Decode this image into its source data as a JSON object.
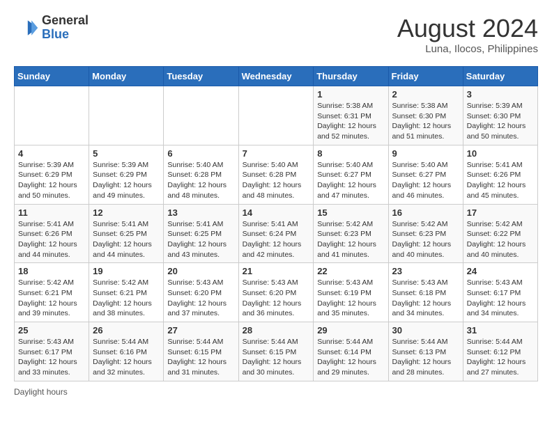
{
  "header": {
    "logo_general": "General",
    "logo_blue": "Blue",
    "month_year": "August 2024",
    "location": "Luna, Ilocos, Philippines"
  },
  "weekdays": [
    "Sunday",
    "Monday",
    "Tuesday",
    "Wednesday",
    "Thursday",
    "Friday",
    "Saturday"
  ],
  "weeks": [
    [
      {
        "day": "",
        "info": ""
      },
      {
        "day": "",
        "info": ""
      },
      {
        "day": "",
        "info": ""
      },
      {
        "day": "",
        "info": ""
      },
      {
        "day": "1",
        "info": "Sunrise: 5:38 AM\nSunset: 6:31 PM\nDaylight: 12 hours and 52 minutes."
      },
      {
        "day": "2",
        "info": "Sunrise: 5:38 AM\nSunset: 6:30 PM\nDaylight: 12 hours and 51 minutes."
      },
      {
        "day": "3",
        "info": "Sunrise: 5:39 AM\nSunset: 6:30 PM\nDaylight: 12 hours and 50 minutes."
      }
    ],
    [
      {
        "day": "4",
        "info": "Sunrise: 5:39 AM\nSunset: 6:29 PM\nDaylight: 12 hours and 50 minutes."
      },
      {
        "day": "5",
        "info": "Sunrise: 5:39 AM\nSunset: 6:29 PM\nDaylight: 12 hours and 49 minutes."
      },
      {
        "day": "6",
        "info": "Sunrise: 5:40 AM\nSunset: 6:28 PM\nDaylight: 12 hours and 48 minutes."
      },
      {
        "day": "7",
        "info": "Sunrise: 5:40 AM\nSunset: 6:28 PM\nDaylight: 12 hours and 48 minutes."
      },
      {
        "day": "8",
        "info": "Sunrise: 5:40 AM\nSunset: 6:27 PM\nDaylight: 12 hours and 47 minutes."
      },
      {
        "day": "9",
        "info": "Sunrise: 5:40 AM\nSunset: 6:27 PM\nDaylight: 12 hours and 46 minutes."
      },
      {
        "day": "10",
        "info": "Sunrise: 5:41 AM\nSunset: 6:26 PM\nDaylight: 12 hours and 45 minutes."
      }
    ],
    [
      {
        "day": "11",
        "info": "Sunrise: 5:41 AM\nSunset: 6:26 PM\nDaylight: 12 hours and 44 minutes."
      },
      {
        "day": "12",
        "info": "Sunrise: 5:41 AM\nSunset: 6:25 PM\nDaylight: 12 hours and 44 minutes."
      },
      {
        "day": "13",
        "info": "Sunrise: 5:41 AM\nSunset: 6:25 PM\nDaylight: 12 hours and 43 minutes."
      },
      {
        "day": "14",
        "info": "Sunrise: 5:41 AM\nSunset: 6:24 PM\nDaylight: 12 hours and 42 minutes."
      },
      {
        "day": "15",
        "info": "Sunrise: 5:42 AM\nSunset: 6:23 PM\nDaylight: 12 hours and 41 minutes."
      },
      {
        "day": "16",
        "info": "Sunrise: 5:42 AM\nSunset: 6:23 PM\nDaylight: 12 hours and 40 minutes."
      },
      {
        "day": "17",
        "info": "Sunrise: 5:42 AM\nSunset: 6:22 PM\nDaylight: 12 hours and 40 minutes."
      }
    ],
    [
      {
        "day": "18",
        "info": "Sunrise: 5:42 AM\nSunset: 6:21 PM\nDaylight: 12 hours and 39 minutes."
      },
      {
        "day": "19",
        "info": "Sunrise: 5:42 AM\nSunset: 6:21 PM\nDaylight: 12 hours and 38 minutes."
      },
      {
        "day": "20",
        "info": "Sunrise: 5:43 AM\nSunset: 6:20 PM\nDaylight: 12 hours and 37 minutes."
      },
      {
        "day": "21",
        "info": "Sunrise: 5:43 AM\nSunset: 6:20 PM\nDaylight: 12 hours and 36 minutes."
      },
      {
        "day": "22",
        "info": "Sunrise: 5:43 AM\nSunset: 6:19 PM\nDaylight: 12 hours and 35 minutes."
      },
      {
        "day": "23",
        "info": "Sunrise: 5:43 AM\nSunset: 6:18 PM\nDaylight: 12 hours and 34 minutes."
      },
      {
        "day": "24",
        "info": "Sunrise: 5:43 AM\nSunset: 6:17 PM\nDaylight: 12 hours and 34 minutes."
      }
    ],
    [
      {
        "day": "25",
        "info": "Sunrise: 5:43 AM\nSunset: 6:17 PM\nDaylight: 12 hours and 33 minutes."
      },
      {
        "day": "26",
        "info": "Sunrise: 5:44 AM\nSunset: 6:16 PM\nDaylight: 12 hours and 32 minutes."
      },
      {
        "day": "27",
        "info": "Sunrise: 5:44 AM\nSunset: 6:15 PM\nDaylight: 12 hours and 31 minutes."
      },
      {
        "day": "28",
        "info": "Sunrise: 5:44 AM\nSunset: 6:15 PM\nDaylight: 12 hours and 30 minutes."
      },
      {
        "day": "29",
        "info": "Sunrise: 5:44 AM\nSunset: 6:14 PM\nDaylight: 12 hours and 29 minutes."
      },
      {
        "day": "30",
        "info": "Sunrise: 5:44 AM\nSunset: 6:13 PM\nDaylight: 12 hours and 28 minutes."
      },
      {
        "day": "31",
        "info": "Sunrise: 5:44 AM\nSunset: 6:12 PM\nDaylight: 12 hours and 27 minutes."
      }
    ]
  ],
  "footer": {
    "daylight_label": "Daylight hours"
  }
}
